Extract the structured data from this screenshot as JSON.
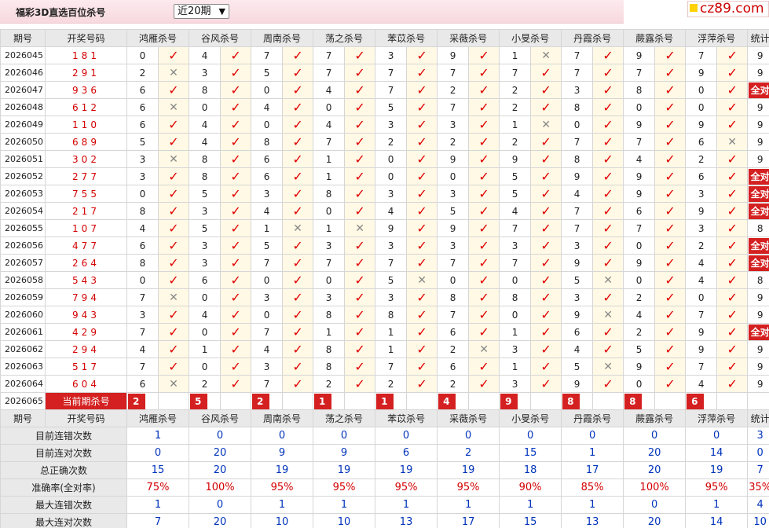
{
  "page": {
    "title": "福彩3D直选百位杀号",
    "period_select": "近20期",
    "logo": "cz89.com"
  },
  "columns": {
    "period": "期号",
    "draw": "开奖号码",
    "experts": [
      "鸿雁杀号",
      "谷风杀号",
      "周南杀号",
      "荡之杀号",
      "苯苡杀号",
      "采薇杀号",
      "小旻杀号",
      "丹霞杀号",
      "蕨露杀号",
      "浮萍杀号"
    ],
    "stat": "统计"
  },
  "rows": [
    {
      "period": "2026045",
      "draw": "181",
      "kills": [
        "0",
        "4",
        "7",
        "7",
        "3",
        "9",
        "1",
        "7",
        "9",
        "7"
      ],
      "ok": [
        1,
        1,
        1,
        1,
        1,
        1,
        0,
        1,
        1,
        1
      ],
      "stat": "9"
    },
    {
      "period": "2026046",
      "draw": "291",
      "kills": [
        "2",
        "3",
        "5",
        "7",
        "7",
        "7",
        "7",
        "7",
        "7",
        "9"
      ],
      "ok": [
        0,
        1,
        1,
        1,
        1,
        1,
        1,
        1,
        1,
        1
      ],
      "stat": "9"
    },
    {
      "period": "2026047",
      "draw": "936",
      "kills": [
        "6",
        "8",
        "0",
        "4",
        "7",
        "2",
        "2",
        "3",
        "8",
        "0"
      ],
      "ok": [
        1,
        1,
        1,
        1,
        1,
        1,
        1,
        1,
        1,
        1
      ],
      "stat": "全对"
    },
    {
      "period": "2026048",
      "draw": "612",
      "kills": [
        "6",
        "0",
        "4",
        "0",
        "5",
        "7",
        "2",
        "8",
        "0",
        "0"
      ],
      "ok": [
        0,
        1,
        1,
        1,
        1,
        1,
        1,
        1,
        1,
        1
      ],
      "stat": "9"
    },
    {
      "period": "2026049",
      "draw": "110",
      "kills": [
        "6",
        "4",
        "0",
        "4",
        "3",
        "3",
        "1",
        "0",
        "9",
        "9"
      ],
      "ok": [
        1,
        1,
        1,
        1,
        1,
        1,
        0,
        1,
        1,
        1
      ],
      "stat": "9"
    },
    {
      "period": "2026050",
      "draw": "689",
      "kills": [
        "5",
        "4",
        "8",
        "7",
        "2",
        "2",
        "2",
        "7",
        "7",
        "6"
      ],
      "ok": [
        1,
        1,
        1,
        1,
        1,
        1,
        1,
        1,
        1,
        0
      ],
      "stat": "9"
    },
    {
      "period": "2026051",
      "draw": "302",
      "kills": [
        "3",
        "8",
        "6",
        "1",
        "0",
        "9",
        "9",
        "8",
        "4",
        "2"
      ],
      "ok": [
        0,
        1,
        1,
        1,
        1,
        1,
        1,
        1,
        1,
        1
      ],
      "stat": "9"
    },
    {
      "period": "2026052",
      "draw": "277",
      "kills": [
        "3",
        "8",
        "6",
        "1",
        "0",
        "0",
        "5",
        "9",
        "9",
        "6"
      ],
      "ok": [
        1,
        1,
        1,
        1,
        1,
        1,
        1,
        1,
        1,
        1
      ],
      "stat": "全对"
    },
    {
      "period": "2026053",
      "draw": "755",
      "kills": [
        "0",
        "5",
        "3",
        "8",
        "3",
        "3",
        "5",
        "4",
        "9",
        "3"
      ],
      "ok": [
        1,
        1,
        1,
        1,
        1,
        1,
        1,
        1,
        1,
        1
      ],
      "stat": "全对"
    },
    {
      "period": "2026054",
      "draw": "217",
      "kills": [
        "8",
        "3",
        "4",
        "0",
        "4",
        "5",
        "4",
        "7",
        "6",
        "9"
      ],
      "ok": [
        1,
        1,
        1,
        1,
        1,
        1,
        1,
        1,
        1,
        1
      ],
      "stat": "全对"
    },
    {
      "period": "2026055",
      "draw": "107",
      "kills": [
        "4",
        "5",
        "1",
        "1",
        "9",
        "9",
        "7",
        "7",
        "7",
        "3"
      ],
      "ok": [
        1,
        1,
        0,
        0,
        1,
        1,
        1,
        1,
        1,
        1
      ],
      "stat": "8"
    },
    {
      "period": "2026056",
      "draw": "477",
      "kills": [
        "6",
        "3",
        "5",
        "3",
        "3",
        "3",
        "3",
        "3",
        "0",
        "2"
      ],
      "ok": [
        1,
        1,
        1,
        1,
        1,
        1,
        1,
        1,
        1,
        1
      ],
      "stat": "全对"
    },
    {
      "period": "2026057",
      "draw": "264",
      "kills": [
        "8",
        "3",
        "7",
        "7",
        "7",
        "7",
        "7",
        "9",
        "9",
        "4"
      ],
      "ok": [
        1,
        1,
        1,
        1,
        1,
        1,
        1,
        1,
        1,
        1
      ],
      "stat": "全对"
    },
    {
      "period": "2026058",
      "draw": "543",
      "kills": [
        "0",
        "6",
        "0",
        "0",
        "5",
        "0",
        "0",
        "5",
        "0",
        "4"
      ],
      "ok": [
        1,
        1,
        1,
        1,
        0,
        1,
        1,
        0,
        1,
        1
      ],
      "stat": "8"
    },
    {
      "period": "2026059",
      "draw": "794",
      "kills": [
        "7",
        "0",
        "3",
        "3",
        "3",
        "8",
        "8",
        "3",
        "2",
        "0"
      ],
      "ok": [
        0,
        1,
        1,
        1,
        1,
        1,
        1,
        1,
        1,
        1
      ],
      "stat": "9"
    },
    {
      "period": "2026060",
      "draw": "943",
      "kills": [
        "3",
        "4",
        "0",
        "8",
        "8",
        "7",
        "0",
        "9",
        "4",
        "7"
      ],
      "ok": [
        1,
        1,
        1,
        1,
        1,
        1,
        1,
        0,
        1,
        1
      ],
      "stat": "9"
    },
    {
      "period": "2026061",
      "draw": "429",
      "kills": [
        "7",
        "0",
        "7",
        "1",
        "1",
        "6",
        "1",
        "6",
        "2",
        "9"
      ],
      "ok": [
        1,
        1,
        1,
        1,
        1,
        1,
        1,
        1,
        1,
        1
      ],
      "stat": "全对"
    },
    {
      "period": "2026062",
      "draw": "294",
      "kills": [
        "4",
        "1",
        "4",
        "8",
        "1",
        "2",
        "3",
        "4",
        "5",
        "9"
      ],
      "ok": [
        1,
        1,
        1,
        1,
        1,
        0,
        1,
        1,
        1,
        1
      ],
      "stat": "9"
    },
    {
      "period": "2026063",
      "draw": "517",
      "kills": [
        "7",
        "0",
        "3",
        "8",
        "7",
        "6",
        "1",
        "5",
        "9",
        "7"
      ],
      "ok": [
        1,
        1,
        1,
        1,
        1,
        1,
        1,
        0,
        1,
        1
      ],
      "stat": "9"
    },
    {
      "period": "2026064",
      "draw": "604",
      "kills": [
        "6",
        "2",
        "7",
        "2",
        "2",
        "2",
        "3",
        "9",
        "0",
        "4"
      ],
      "ok": [
        0,
        1,
        1,
        1,
        1,
        1,
        1,
        1,
        1,
        1
      ],
      "stat": "9"
    }
  ],
  "current": {
    "period": "2026065",
    "label": "当前期杀号",
    "kills": [
      "2",
      "5",
      "2",
      "1",
      "1",
      "4",
      "9",
      "8",
      "8",
      "6"
    ]
  },
  "summary": [
    {
      "label": "目前连错次数",
      "values": [
        "1",
        "0",
        "0",
        "0",
        "0",
        "0",
        "0",
        "0",
        "0",
        "0"
      ],
      "stat": "3",
      "pct": false
    },
    {
      "label": "目前连对次数",
      "values": [
        "0",
        "20",
        "9",
        "9",
        "6",
        "2",
        "15",
        "1",
        "20",
        "14"
      ],
      "stat": "0",
      "pct": false
    },
    {
      "label": "总正确次数",
      "values": [
        "15",
        "20",
        "19",
        "19",
        "19",
        "19",
        "18",
        "17",
        "20",
        "19"
      ],
      "stat": "7",
      "pct": false
    },
    {
      "label": "准确率(全对率)",
      "values": [
        "75%",
        "100%",
        "95%",
        "95%",
        "95%",
        "95%",
        "90%",
        "85%",
        "100%",
        "95%"
      ],
      "stat": "35%",
      "pct": true
    },
    {
      "label": "最大连错次数",
      "values": [
        "1",
        "0",
        "1",
        "1",
        "1",
        "1",
        "1",
        "1",
        "0",
        "1"
      ],
      "stat": "4",
      "pct": false
    },
    {
      "label": "最大连对次数",
      "values": [
        "7",
        "20",
        "10",
        "10",
        "13",
        "17",
        "15",
        "13",
        "20",
        "14"
      ],
      "stat": "10",
      "pct": false
    }
  ],
  "icons": {
    "correct": "check-icon",
    "wrong": "cross-icon"
  },
  "colors": {
    "accent": "#d42020",
    "mark_bg": "#fff9e5",
    "header_bg": "#e9e9e9",
    "summary_blue": "#0033bb"
  }
}
